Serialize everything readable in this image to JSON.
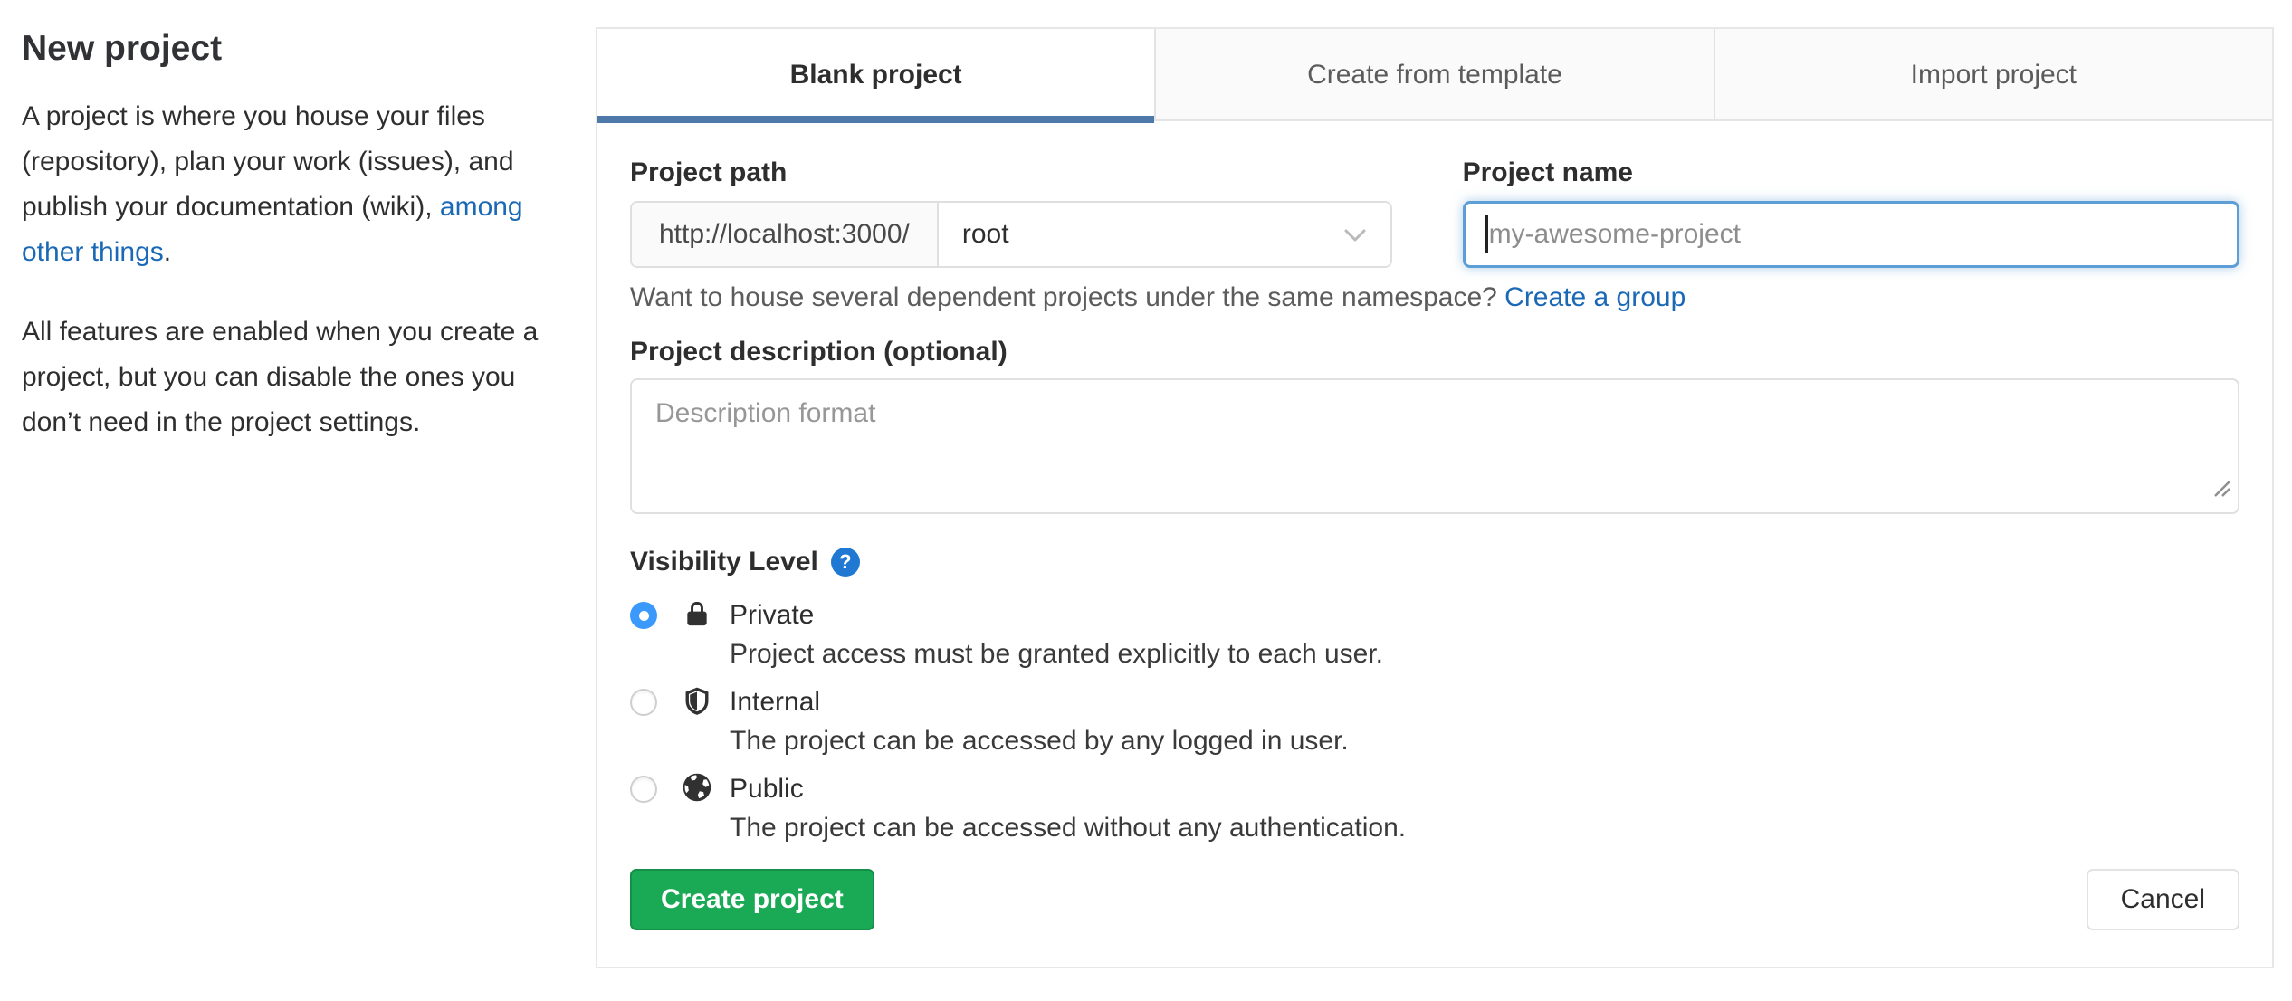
{
  "sidebar": {
    "title": "New project",
    "intro": {
      "text_before_link": "A project is where you house your files (repository), plan your work (issues), and publish your documentation (wiki), ",
      "link_text": "among other things",
      "text_after_link": "."
    },
    "features_note": "All features are enabled when you create a project, but you can disable the ones you don’t need in the project settings."
  },
  "tabs": [
    {
      "label": "Blank project",
      "active": true
    },
    {
      "label": "Create from template",
      "active": false
    },
    {
      "label": "Import project",
      "active": false
    }
  ],
  "form": {
    "project_path": {
      "label": "Project path",
      "url_prefix": "http://localhost:3000/",
      "namespace_selected": "root"
    },
    "project_name": {
      "label": "Project name",
      "placeholder": "my-awesome-project",
      "value": ""
    },
    "namespace_hint": {
      "text_before_link": "Want to house several dependent projects under the same namespace? ",
      "link_text": "Create a group"
    },
    "description": {
      "label": "Project description (optional)",
      "placeholder": "Description format",
      "value": ""
    },
    "visibility": {
      "label": "Visibility Level",
      "help_glyph": "?",
      "options": [
        {
          "label": "Private",
          "icon": "lock-icon",
          "selected": true,
          "description": "Project access must be granted explicitly to each user."
        },
        {
          "label": "Internal",
          "icon": "shield-half-icon",
          "selected": false,
          "description": "The project can be accessed by any logged in user."
        },
        {
          "label": "Public",
          "icon": "globe-icon",
          "selected": false,
          "description": "The project can be accessed without any authentication."
        }
      ]
    },
    "actions": {
      "submit_label": "Create project",
      "cancel_label": "Cancel"
    }
  },
  "colors": {
    "link": "#1b69b6",
    "active_tab_underline": "#4e79a8",
    "primary_button": "#1aaa55",
    "selected_radio": "#3b99fc",
    "help_icon": "#1f78d1",
    "focus_border": "#5e9ed6"
  }
}
